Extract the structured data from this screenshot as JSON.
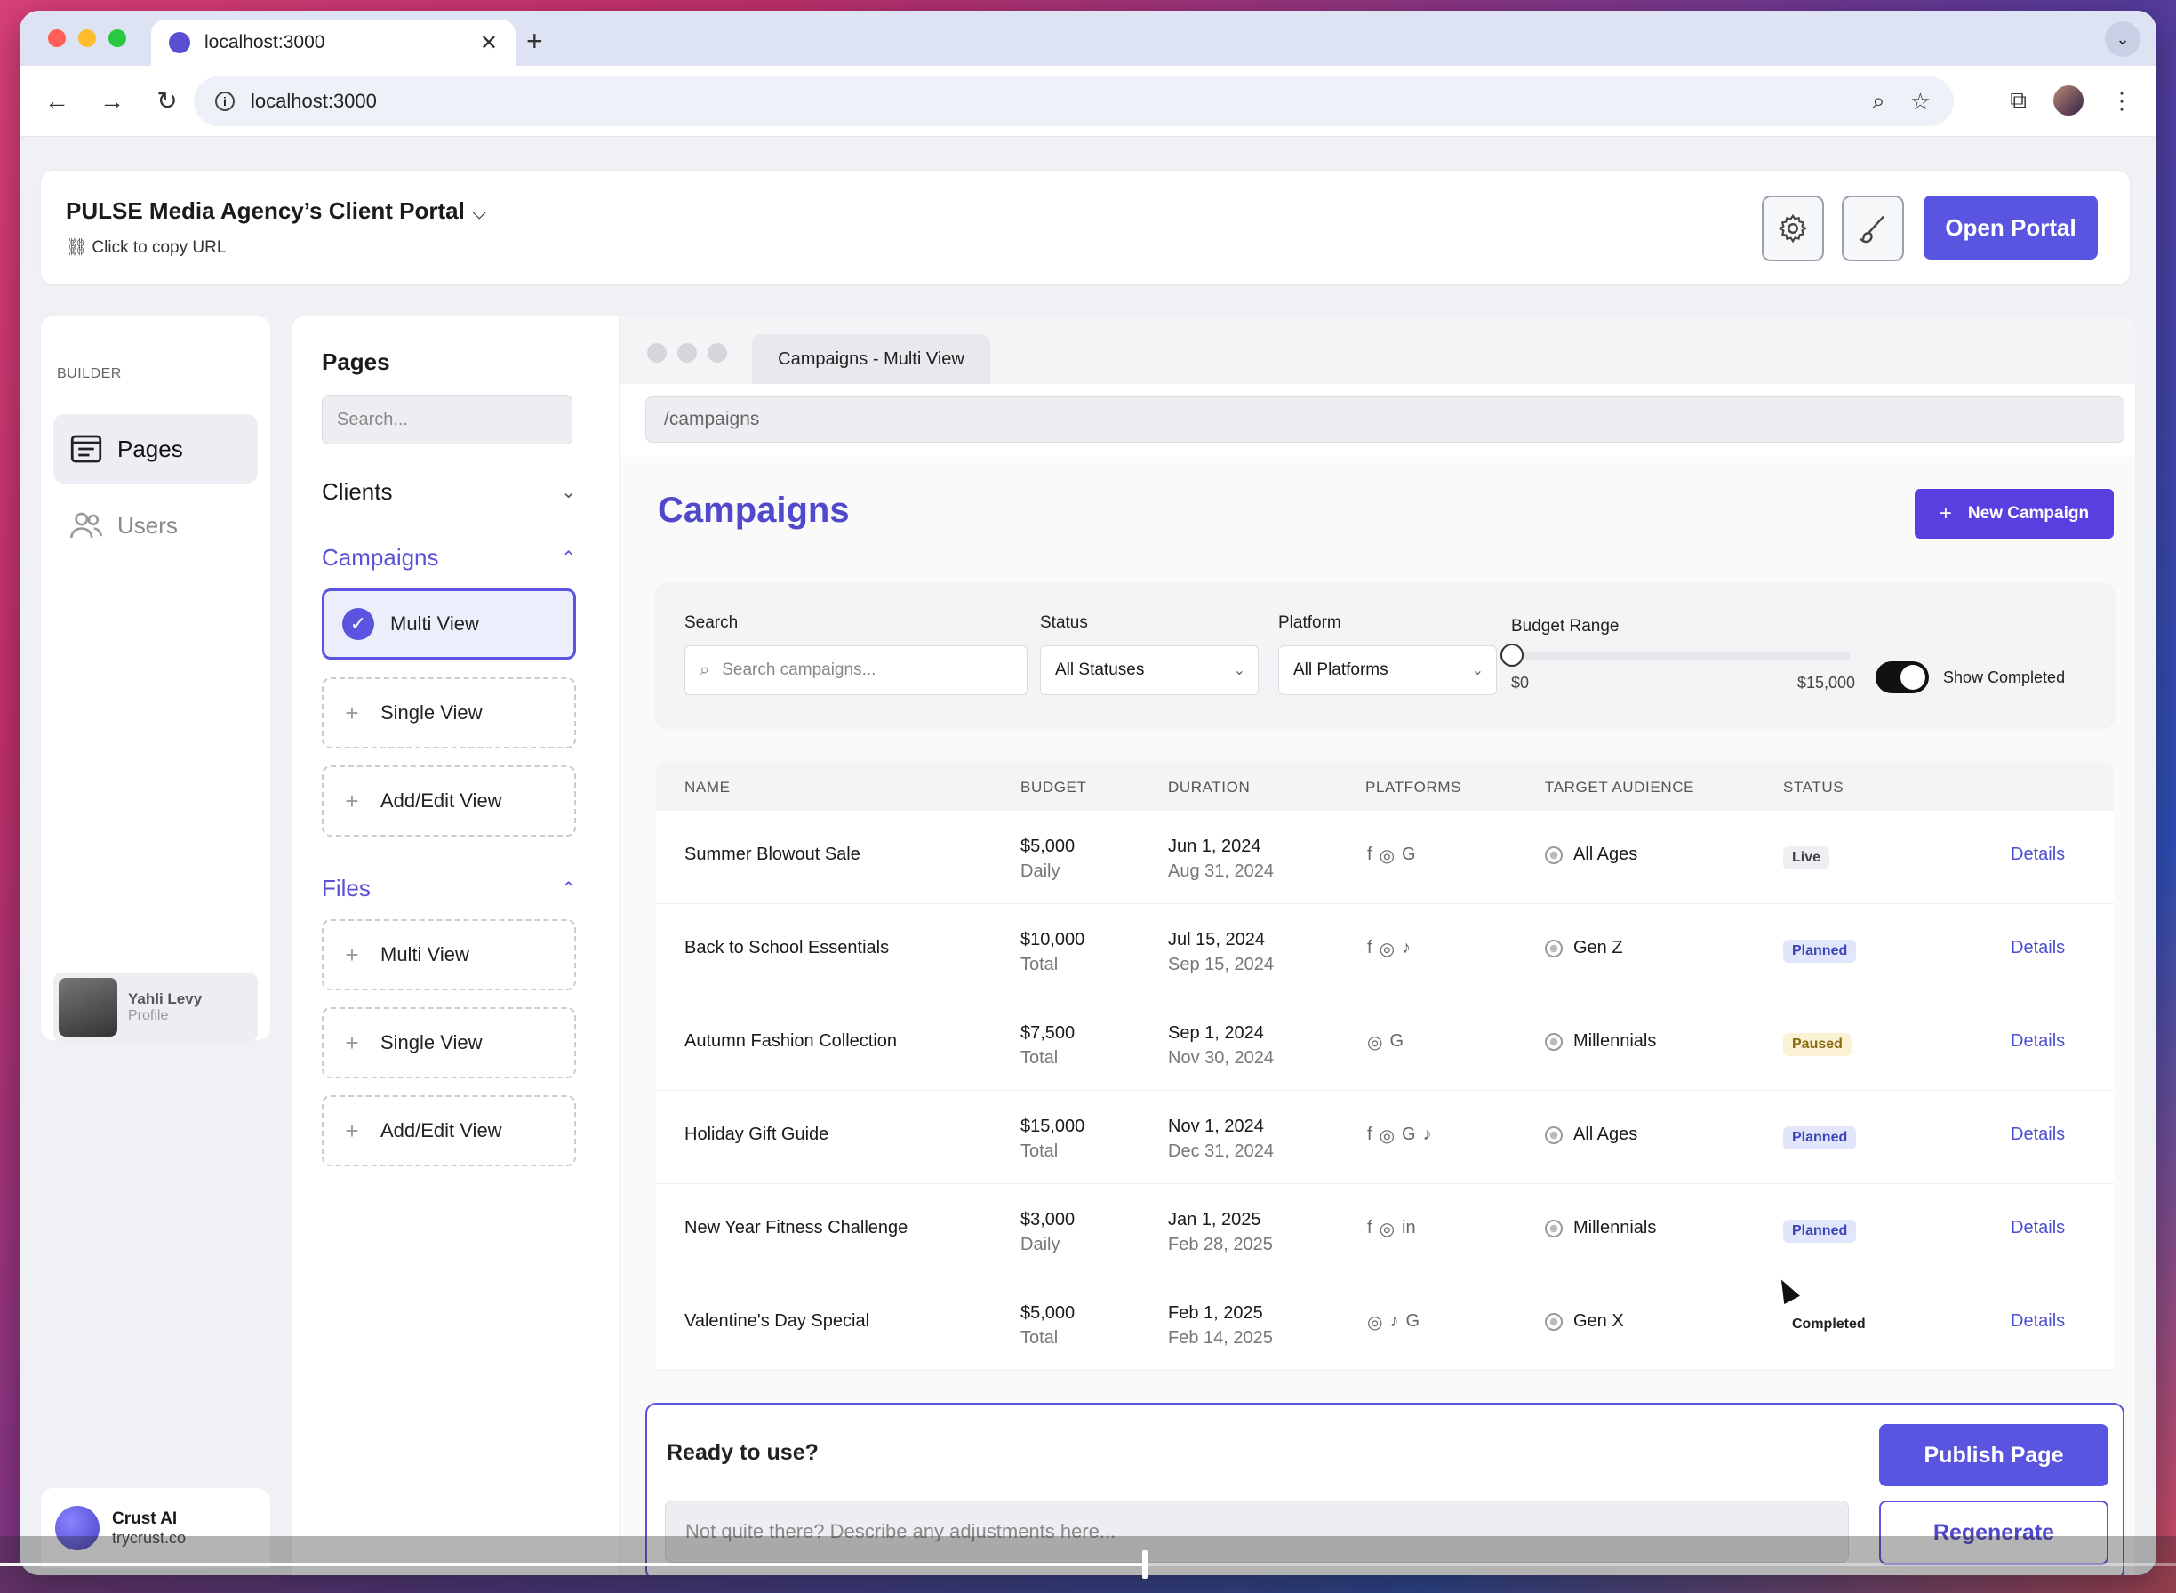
{
  "browser": {
    "tab_title": "localhost:3000",
    "url": "localhost:3000"
  },
  "header": {
    "title": "PULSE Media Agency’s Client Portal",
    "copy_url": "Click to copy URL",
    "open_portal": "Open Portal"
  },
  "sidebar": {
    "section": "BUILDER",
    "items": [
      {
        "label": "Pages"
      },
      {
        "label": "Users"
      }
    ],
    "profile": {
      "name": "Yahli Levy",
      "sub": "Profile"
    },
    "brand": {
      "name": "Crust AI",
      "domain": "trycrust.co"
    }
  },
  "pages_panel": {
    "title": "Pages",
    "search_placeholder": "Search...",
    "sections": [
      {
        "label": "Clients"
      },
      {
        "label": "Campaigns",
        "items": [
          {
            "label": "Multi View"
          },
          {
            "label": "Single View"
          },
          {
            "label": "Add/Edit View"
          }
        ]
      },
      {
        "label": "Files",
        "items": [
          {
            "label": "Multi View"
          },
          {
            "label": "Single View"
          },
          {
            "label": "Add/Edit View"
          }
        ]
      }
    ]
  },
  "preview": {
    "tab": "Campaigns  - Multi View",
    "path": "/campaigns",
    "title": "Campaigns",
    "new_button": "New Campaign",
    "filters": {
      "search_label": "Search",
      "search_placeholder": "Search campaigns...",
      "status_label": "Status",
      "status_value": "All Statuses",
      "platform_label": "Platform",
      "platform_value": "All Platforms",
      "budget_label": "Budget Range",
      "budget_min": "$0",
      "budget_max": "$15,000",
      "show_completed": "Show Completed",
      "show_completed_on": true
    },
    "columns": [
      "NAME",
      "BUDGET",
      "DURATION",
      "PLATFORMS",
      "TARGET AUDIENCE",
      "STATUS"
    ],
    "rows": [
      {
        "name": "Summer Blowout Sale",
        "budget": "$5,000",
        "budget_type": "Daily",
        "start": "Jun 1, 2024",
        "end": "Aug 31, 2024",
        "platforms": [
          "facebook-icon",
          "instagram-icon",
          "google-icon"
        ],
        "audience": "All Ages",
        "status": "Live",
        "action": "Details"
      },
      {
        "name": "Back to School Essentials",
        "budget": "$10,000",
        "budget_type": "Total",
        "start": "Jul 15, 2024",
        "end": "Sep 15, 2024",
        "platforms": [
          "facebook-icon",
          "instagram-icon",
          "tiktok-icon"
        ],
        "audience": "Gen Z",
        "status": "Planned",
        "action": "Details"
      },
      {
        "name": "Autumn Fashion Collection",
        "budget": "$7,500",
        "budget_type": "Total",
        "start": "Sep 1, 2024",
        "end": "Nov 30, 2024",
        "platforms": [
          "instagram-icon",
          "google-icon"
        ],
        "audience": "Millennials",
        "status": "Paused",
        "action": "Details"
      },
      {
        "name": "Holiday Gift Guide",
        "budget": "$15,000",
        "budget_type": "Total",
        "start": "Nov 1, 2024",
        "end": "Dec 31, 2024",
        "platforms": [
          "facebook-icon",
          "instagram-icon",
          "google-icon",
          "tiktok-icon"
        ],
        "audience": "All Ages",
        "status": "Planned",
        "action": "Details"
      },
      {
        "name": "New Year Fitness Challenge",
        "budget": "$3,000",
        "budget_type": "Daily",
        "start": "Jan 1, 2025",
        "end": "Feb 28, 2025",
        "platforms": [
          "facebook-icon",
          "instagram-icon",
          "linkedin-icon"
        ],
        "audience": "Millennials",
        "status": "Planned",
        "action": "Details"
      },
      {
        "name": "Valentine's Day Special",
        "budget": "$5,000",
        "budget_type": "Total",
        "start": "Feb 1, 2025",
        "end": "Feb 14, 2025",
        "platforms": [
          "instagram-icon",
          "tiktok-icon",
          "google-icon"
        ],
        "audience": "Gen X",
        "status": "Completed",
        "action": "Details"
      }
    ]
  },
  "publish": {
    "question": "Ready to use?",
    "placeholder": "Not quite there? Describe any adjustments here...",
    "publish_button": "Publish Page",
    "regenerate_button": "Regenerate"
  },
  "video": {
    "progress": 0.525
  },
  "colors": {
    "accent": "#5a55e0",
    "title": "#5149cc"
  }
}
